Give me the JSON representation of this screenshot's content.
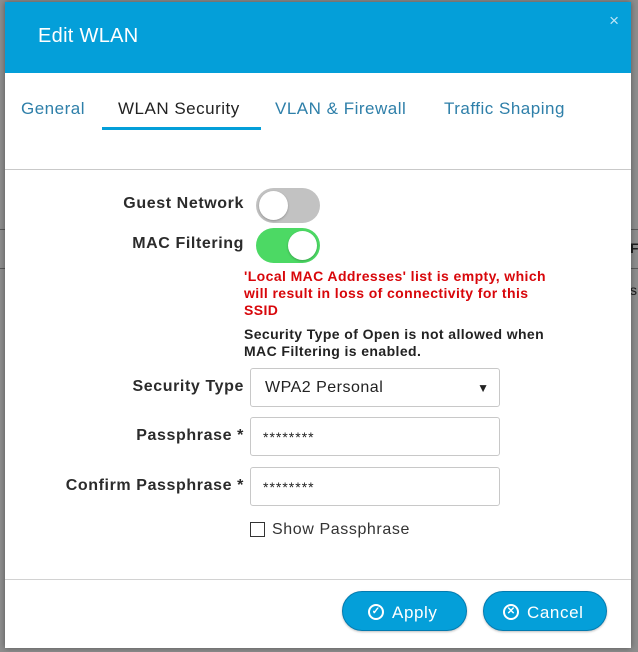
{
  "dialog": {
    "title": "Edit WLAN",
    "close_icon": "×"
  },
  "tabs": [
    {
      "label": "General",
      "active": false
    },
    {
      "label": "WLAN Security",
      "active": true
    },
    {
      "label": "VLAN & Firewall",
      "active": false
    },
    {
      "label": "Traffic Shaping",
      "active": false
    }
  ],
  "form": {
    "guest_network": {
      "label": "Guest Network",
      "enabled": false
    },
    "mac_filtering": {
      "label": "MAC Filtering",
      "enabled": true
    },
    "warning": "'Local MAC Addresses' list is empty, which will result in loss of connectivity for this SSID",
    "note": "Security Type of Open is not allowed when MAC Filtering is enabled.",
    "security_type": {
      "label": "Security Type",
      "value": "WPA2 Personal",
      "arrow": "▼"
    },
    "passphrase": {
      "label": "Passphrase *",
      "value": "********"
    },
    "confirm_passphrase": {
      "label": "Confirm Passphrase *",
      "value": "********"
    },
    "show_passphrase": {
      "label": "Show Passphrase",
      "checked": false
    }
  },
  "buttons": {
    "apply": {
      "label": "Apply",
      "icon": "✓"
    },
    "cancel": {
      "label": "Cancel",
      "icon": "✕"
    }
  },
  "background": {
    "col_letter": "F",
    "col_letter2": "s"
  },
  "colors": {
    "header": "#049fd9",
    "toggle_on": "#4cd964",
    "warning": "#d8060a",
    "tab_link": "#2e7fa9"
  }
}
